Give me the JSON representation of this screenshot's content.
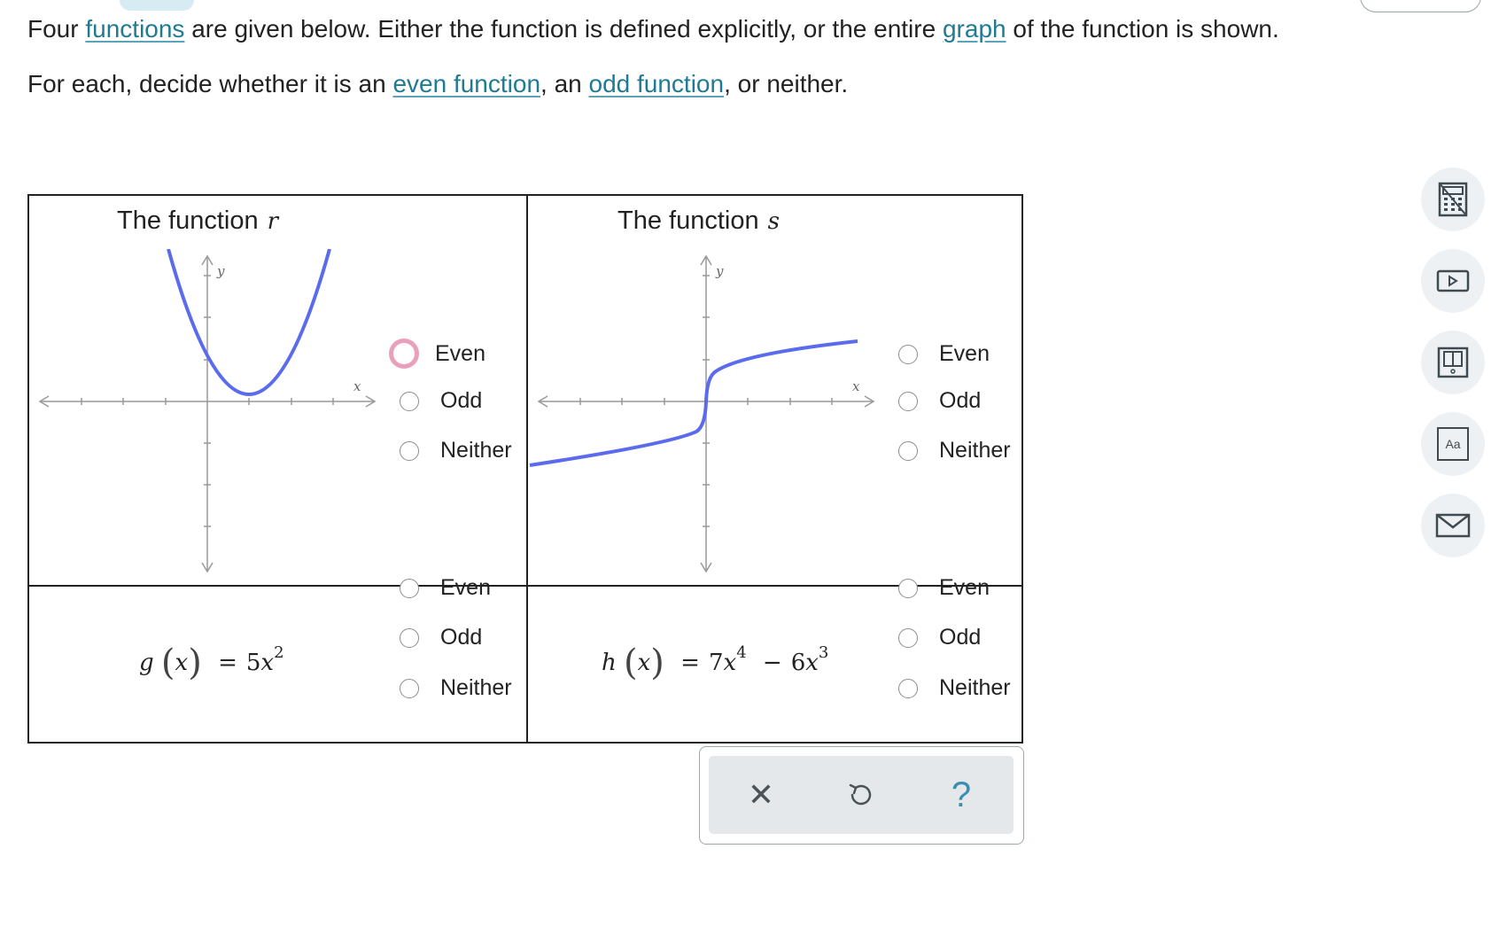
{
  "prompt": {
    "line1": {
      "t1": "Four ",
      "link_functions": "functions",
      "t2": " are given below. Either the function is defined explicitly, or the entire ",
      "link_graph": "graph",
      "t3": " of the function is shown."
    },
    "line2": {
      "t1": "For each, decide whether it is an ",
      "link_even": "even function",
      "t2": ", an ",
      "link_odd": "odd function",
      "t3": ", or neither."
    }
  },
  "cells": {
    "r": {
      "title": "The function",
      "var": "r",
      "axis_x": "x",
      "axis_y": "y",
      "options": [
        "Even",
        "Odd",
        "Neither"
      ],
      "selected": "Even"
    },
    "s": {
      "title": "The function",
      "var": "s",
      "axis_x": "x",
      "axis_y": "y",
      "options": [
        "Even",
        "Odd",
        "Neither"
      ],
      "selected": null
    },
    "g": {
      "formula": {
        "name": "g",
        "lparen": "(",
        "arg": "x",
        "rparen": ")",
        "eq": "=",
        "coef": "5",
        "var": "x",
        "exp": "2"
      },
      "options": [
        "Even",
        "Odd",
        "Neither"
      ],
      "selected": null
    },
    "h": {
      "formula": {
        "name": "h",
        "lparen": "(",
        "arg": "x",
        "rparen": ")",
        "eq": "=",
        "coef1": "7",
        "var1": "x",
        "exp1": "4",
        "op": "−",
        "coef2": "6",
        "var2": "x",
        "exp2": "3"
      },
      "options": [
        "Even",
        "Odd",
        "Neither"
      ],
      "selected": null
    }
  },
  "actions": {
    "clear_symbol": "✕",
    "help_symbol": "?"
  },
  "tools": [
    "calculator-icon",
    "video-icon",
    "textbook-icon",
    "glossary-icon",
    "email-icon"
  ],
  "tool_labels": {
    "glossary": "Aa"
  },
  "colors": {
    "link": "#1f7a93",
    "curve": "#5b6bee",
    "selected_radio": "#e9a0bb"
  }
}
